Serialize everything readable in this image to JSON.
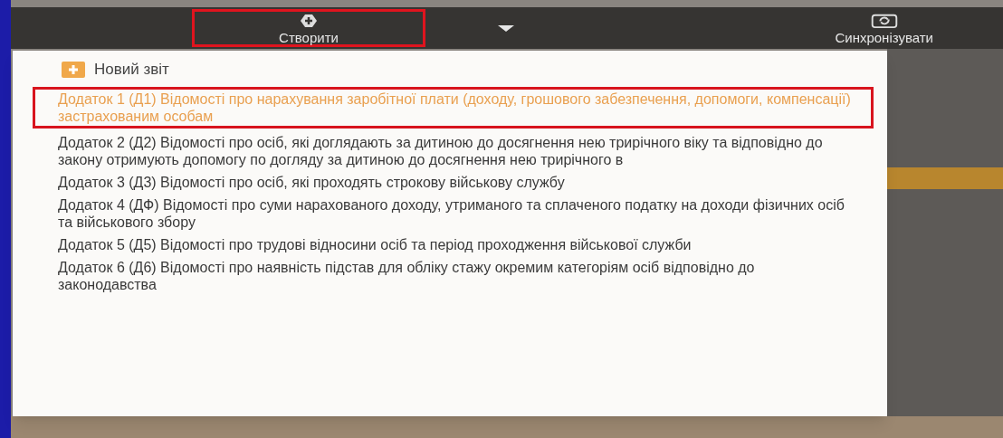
{
  "toolbar": {
    "buttons": [
      {
        "kind": "create",
        "label": "Створити",
        "selected": true
      },
      {
        "kind": "sync",
        "label": "Синхронізувати",
        "selected": false
      }
    ]
  },
  "menu": {
    "header": "Новий звіт",
    "items": [
      {
        "label": "Додаток 1 (Д1) Відомості про нарахування заробітної плати (доходу, грошового забезпечення, допомоги, компенсації) застрахованим особам",
        "selected": true
      },
      {
        "label": "Додаток 2 (Д2) Відомості про осіб, які доглядають за дитиною до досягнення нею трирічного віку та відповідно до закону отримують допомогу по догляду за дитиною до досягнення нею трирічного в",
        "selected": false
      },
      {
        "label": "Додаток 3 (Д3) Відомості про осіб, які проходять строкову військову службу",
        "selected": false
      },
      {
        "label": "Додаток 4 (ДФ) Відомості про суми нарахованого доходу, утриманого та сплаченого податку на доходи фізичних осіб та військового збору",
        "selected": false
      },
      {
        "label": "Додаток 5 (Д5) Відомості про трудові відносини осіб та період проходження військової служби",
        "selected": false
      },
      {
        "label": "Додаток 6 (Д6) Відомості про наявність підстав для обліку стажу окремим категоріям осіб відповідно до законодавства",
        "selected": false
      }
    ]
  }
}
